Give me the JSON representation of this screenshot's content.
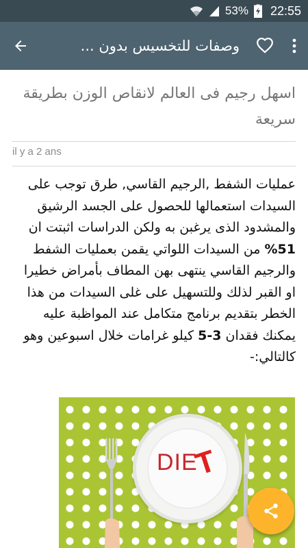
{
  "status_bar": {
    "battery_percent": "53%",
    "time": "22:55",
    "icons": [
      "wifi-icon",
      "signal-icon",
      "battery-charging-icon"
    ]
  },
  "app_bar": {
    "title": "وصفات للتخسيس بدون ...",
    "icons": [
      "back-arrow-icon",
      "heart-icon",
      "more-vert-icon"
    ]
  },
  "article": {
    "title": "اسهل رجيم فى العالم لانقاص الوزن بطريقة سريعة",
    "timestamp": "il y a 2 ans",
    "body_part1": "عمليات الشفط ,الرجيم القاسي, طرق توجب على السيدات استعمالها للحصول على الجسد الرشيق والمشدود الذى يرغبن به ولكن الدراسات اثبتت ان ",
    "body_bold1": "51%",
    "body_part2": " من السيدات اللواتي يقمن بعمليات الشفط والرجيم القاسي ينتهى بهن المطاف بأمراض خطيرا او القبر لذلك وللتسهيل على غلى السيدات من هذا الخطر بتقديم برنامج متكامل عند المواظبة عليه يمكنك فقدان ",
    "body_bold2": "3-5",
    "body_part3": " كيلو غرامات خلال اسبوعين وهو كالتالي:-",
    "image": {
      "plate_text": "DIE",
      "plate_text_accent": "T"
    }
  },
  "fab": {
    "icon": "share-icon"
  },
  "colors": {
    "status_bar": "#3a4a53",
    "app_bar": "#4e6470",
    "fab": "#fdb42b",
    "image_bg": "#a9c534"
  }
}
